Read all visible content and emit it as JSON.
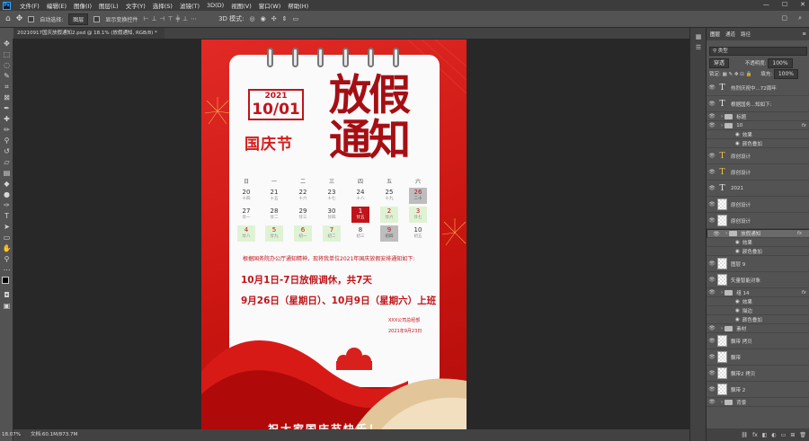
{
  "menubar": {
    "app_icon": "Ps",
    "items": [
      "文件(F)",
      "编辑(E)",
      "图像(I)",
      "图层(L)",
      "文字(Y)",
      "选择(S)",
      "滤镜(T)",
      "3D(D)",
      "视图(V)",
      "窗口(W)",
      "帮助(H)"
    ],
    "window_controls": [
      "—",
      "☐",
      "✕"
    ]
  },
  "options": {
    "auto_select_label": "自动选择:",
    "auto_select_value": "图层",
    "transform_label": "显示变换控件"
  },
  "document": {
    "tab_title": "20210917国庆放假通知2.psd @ 18.1% (放假通知, RGB/8) *",
    "zoom": "18.07%",
    "doc_info": "文档:60.1M/873.7M"
  },
  "artwork": {
    "year": "2021",
    "month_day": "10/01",
    "holiday_name": "国庆节",
    "title": "放假通知",
    "weekdays": [
      "日",
      "一",
      "二",
      "三",
      "四",
      "五",
      "六"
    ],
    "calendar": [
      {
        "n": "20",
        "s": "十四"
      },
      {
        "n": "21",
        "s": "十五"
      },
      {
        "n": "22",
        "s": "十六"
      },
      {
        "n": "23",
        "s": "十七"
      },
      {
        "n": "24",
        "s": "十八"
      },
      {
        "n": "25",
        "s": "十九"
      },
      {
        "n": "26",
        "s": "二十"
      },
      {
        "n": "27",
        "s": "廿一"
      },
      {
        "n": "28",
        "s": "廿二"
      },
      {
        "n": "29",
        "s": "廿三"
      },
      {
        "n": "30",
        "s": "廿四"
      },
      {
        "n": "1",
        "s": "廿五"
      },
      {
        "n": "2",
        "s": "廿六"
      },
      {
        "n": "3",
        "s": "廿七"
      },
      {
        "n": "4",
        "s": "廿八"
      },
      {
        "n": "5",
        "s": "廿九"
      },
      {
        "n": "6",
        "s": "初一"
      },
      {
        "n": "7",
        "s": "初二"
      },
      {
        "n": "8",
        "s": "初三"
      },
      {
        "n": "9",
        "s": "初四"
      },
      {
        "n": "10",
        "s": "初五"
      }
    ],
    "notice": "根据国务院办公厅通知精神，现将我单位2021年国庆放假安排通知如下:",
    "line1": "10月1日-7日放假调休，共7天",
    "line2": "9月26日（星期日）、10月9日（星期六）上班",
    "company": "XXX公司总经部",
    "sign_date": "2021年9月23日",
    "bottom_text": "祝大家国庆节快乐！"
  },
  "panel": {
    "tabs": [
      "图层",
      "通道",
      "路径"
    ],
    "kind": "类型",
    "blend": "穿透",
    "opacity_label": "不透明度:",
    "opacity": "100%",
    "lock_label": "锁定:",
    "fill_label": "填充:",
    "fill": "100%",
    "layers": [
      {
        "name": "热烈庆祝中...72周年",
        "type": "text"
      },
      {
        "name": "根据国务...知如下:",
        "type": "text"
      },
      {
        "name": "标题",
        "type": "folder"
      },
      {
        "name": "10",
        "type": "folder",
        "fx": "fx"
      },
      {
        "name": "效果",
        "type": "sub"
      },
      {
        "name": "颜色叠加",
        "type": "sub"
      },
      {
        "name": "原创设计",
        "type": "text-warn"
      },
      {
        "name": "原创设计",
        "type": "text-warn"
      },
      {
        "name": "2021",
        "type": "text"
      },
      {
        "name": "原创设计",
        "type": "raster"
      },
      {
        "name": "原创设计",
        "type": "raster"
      },
      {
        "name": "放假通知",
        "type": "folder-sel",
        "fx": "fx"
      },
      {
        "name": "效果",
        "type": "sub"
      },
      {
        "name": "颜色叠加",
        "type": "sub"
      },
      {
        "name": "图层 9",
        "type": "raster"
      },
      {
        "name": "矢量智能对象",
        "type": "raster"
      },
      {
        "name": "组 14",
        "type": "folder",
        "fx": "fx"
      },
      {
        "name": "效果",
        "type": "sub"
      },
      {
        "name": "描边",
        "type": "sub"
      },
      {
        "name": "颜色叠加",
        "type": "sub"
      },
      {
        "name": "素材",
        "type": "folder"
      },
      {
        "name": "飘带 拷贝",
        "type": "raster"
      },
      {
        "name": "飘带",
        "type": "raster"
      },
      {
        "name": "飘带2 拷贝",
        "type": "raster"
      },
      {
        "name": "飘带 2",
        "type": "raster"
      },
      {
        "name": "背景",
        "type": "folder"
      }
    ]
  }
}
